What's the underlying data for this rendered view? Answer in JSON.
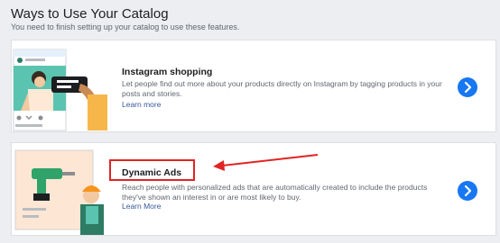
{
  "section": {
    "title": "Ways to Use Your Catalog",
    "subtitle": "You need to finish setting up your catalog to use these features."
  },
  "features": [
    {
      "title": "Instagram shopping",
      "description": "Let people find out more about your products directly on Instagram by tagging products in your posts and stories.",
      "link": "Learn more",
      "icon": "chevron-right-icon"
    },
    {
      "title": "Dynamic Ads",
      "description": "Reach people with personalized ads that are automatically created to include the products they've shown an interest in or are most likely to buy.",
      "link": "Learn More",
      "icon": "chevron-right-icon"
    }
  ],
  "colors": {
    "accent": "#1877f2",
    "link": "#385898",
    "annotation": "#e02424"
  }
}
